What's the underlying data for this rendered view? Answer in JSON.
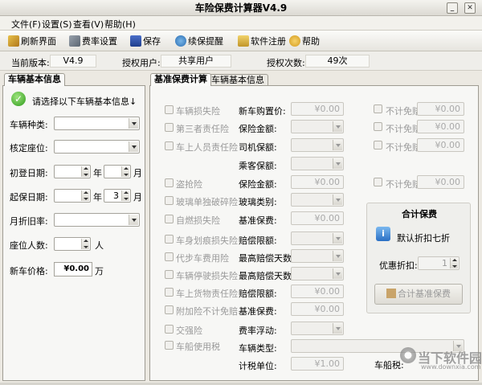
{
  "window": {
    "title": "车险保费计算器V4.9"
  },
  "menu": [
    "文件(F)",
    "设置(S)",
    "查看(V)",
    "帮助(H)"
  ],
  "toolbar": [
    "刷新界面",
    "费率设置",
    "保存",
    "续保提醒",
    "软件注册",
    "帮助"
  ],
  "info": {
    "version_label": "当前版本:",
    "version_value": "V4.9",
    "user_label": "授权用户:",
    "user_value": "共享用户",
    "count_label": "授权次数:",
    "count_value": "49次"
  },
  "left": {
    "tab": "车辆基本信息",
    "prompt": "请选择以下车辆基本信息↓",
    "vehicle_type": "车辆种类:",
    "seats": "核定座位:",
    "first_reg": "初登日期:",
    "start_date": "起保日期:",
    "year": "年",
    "month": "月",
    "start_month": "3",
    "depr_rate": "月折旧率:",
    "seat_people": "座位人数:",
    "person_unit": "人",
    "new_price": "新车价格:",
    "new_price_value": "¥0.00",
    "wan": "万"
  },
  "right": {
    "tabs": [
      "基准保费计算",
      "车辆基本信息"
    ],
    "coverages": [
      "车辆损失险",
      "第三者责任险",
      "车上人员责任险",
      "盗抢险",
      "玻璃单独破碎险",
      "自燃损失险",
      "车身划痕损失险",
      "代步车费用险",
      "车辆停驶损失险",
      "车上货物责任险",
      "附加险不计免赔",
      "交强险",
      "车船使用税"
    ],
    "fields": [
      "新车购置价:",
      "保险金额:",
      "司机保额:",
      "乘客保额:",
      "保险金额:",
      "玻璃类别:",
      "基准保费:",
      "赔偿限额:",
      "最高赔偿天数:",
      "最高赔偿天数:",
      "赔偿限额:",
      "基准保费:",
      "费率浮动:",
      "车辆类型:",
      "计税单位:"
    ],
    "zero": "¥0.00",
    "one": "¥1.00",
    "no_deduct": "不计免赔",
    "total": {
      "title": "合计保费",
      "note": "默认折扣七折",
      "discount_label": "优惠折扣:",
      "discount_value": "1",
      "button": "合计基准保费"
    },
    "vehicle_tax_label": "车船税:"
  },
  "watermark": {
    "text": "当下软件园",
    "url": "www.downxia.com"
  }
}
